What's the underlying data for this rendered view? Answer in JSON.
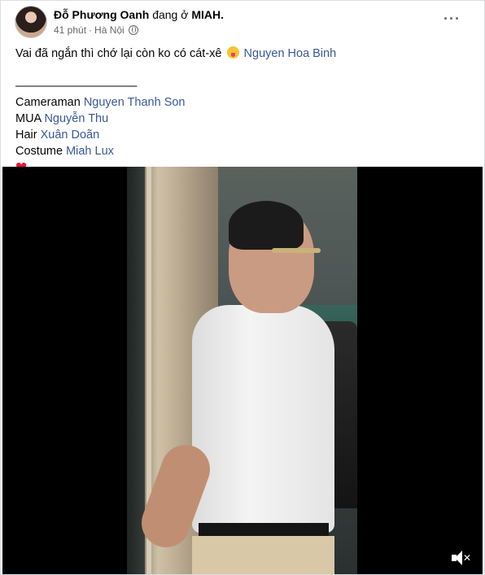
{
  "post": {
    "author": "Đỗ Phương Oanh",
    "at_text": "đang ở",
    "place": "MIAH.",
    "time": "41 phút",
    "location": "Hà Nội",
    "privacy_icon": "globe-icon",
    "more_icon": "ellipsis-icon"
  },
  "text": {
    "line1_text": "Vai đã ngắn thì chớ lại còn ko có cát-xê",
    "line1_emoji": "tongue-emoji",
    "line1_tag": "Nguyen Hoa Binh",
    "separator": "———————————",
    "credits": [
      {
        "role": "Cameraman",
        "name": "Nguyen Thanh Son"
      },
      {
        "role": "MUA",
        "name": "Nguyễn Thu"
      },
      {
        "role": "Hair",
        "name": "Xuân Doãn"
      },
      {
        "role": "Costume",
        "name": "Miah Lux"
      }
    ],
    "heart": "❤"
  },
  "video": {
    "mute_icon": "speaker-muted-icon"
  },
  "colors": {
    "link": "#385898",
    "secondary": "#65676b",
    "heart": "#e4162d"
  }
}
